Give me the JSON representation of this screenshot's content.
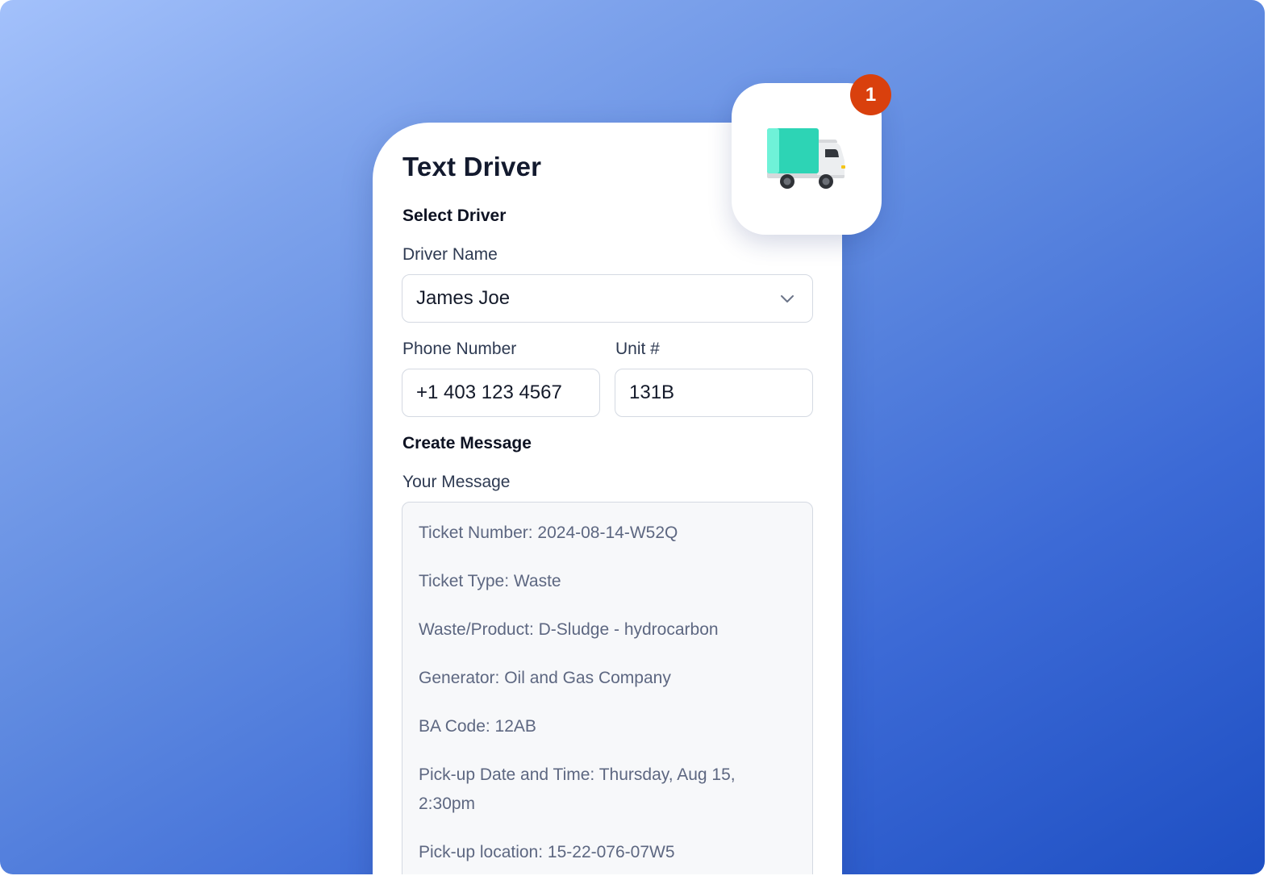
{
  "form": {
    "title": "Text Driver",
    "select_driver_heading": "Select Driver",
    "driver_name_label": "Driver Name",
    "driver_name_value": "James Joe",
    "phone_label": "Phone Number",
    "phone_value": "+1 403 123 4567",
    "unit_label": "Unit #",
    "unit_value": "131B",
    "create_message_heading": "Create Message",
    "message_label": "Your Message",
    "message_lines": [
      "Ticket Number: 2024-08-14-W52Q",
      "Ticket Type: Waste",
      "Waste/Product: D-Sludge - hydrocarbon",
      "Generator: Oil and Gas Company",
      "BA Code: 12AB",
      "Pick-up Date and Time: Thursday, Aug 15, 2:30pm",
      "Pick-up location: 15-22-076-07W5"
    ]
  },
  "app_icon": {
    "icon": "truck-icon",
    "badge_count": "1",
    "badge_color": "#d9400d"
  },
  "colors": {
    "gradient_start": "#a3c1fb",
    "gradient_end": "#1e4fc3",
    "truck_cargo": "#2dd4b5"
  }
}
